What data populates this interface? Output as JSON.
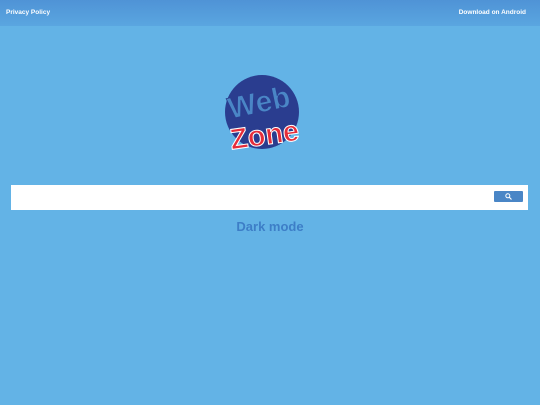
{
  "header": {
    "privacy_label": "Privacy Policy",
    "download_label": "Download on Android"
  },
  "logo": {
    "line1": "Web",
    "line2": "Zone"
  },
  "search": {
    "value": "",
    "placeholder": "",
    "button_icon": "search-icon"
  },
  "dark_mode": {
    "label": "Dark mode"
  },
  "colors": {
    "background": "#63b3e6",
    "topbar": "#4f93d6",
    "logo_circle": "#2a3d8f",
    "logo_web": "#4a86c6",
    "logo_zone": "#e52d3a",
    "search_button": "#4a86c6",
    "dark_mode_text": "#3d7ec7"
  }
}
